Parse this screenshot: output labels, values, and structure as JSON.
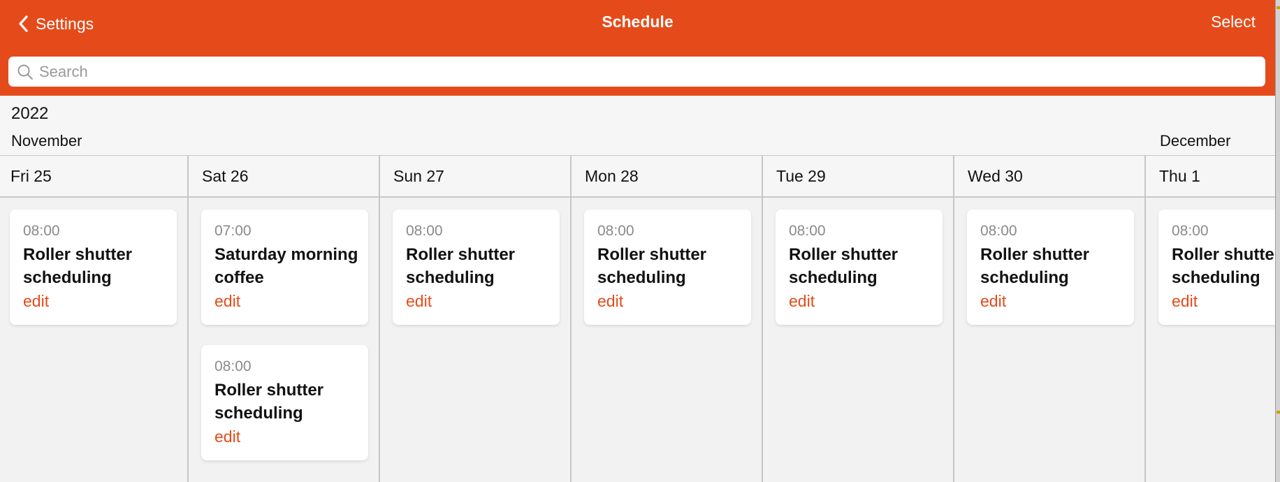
{
  "navbar": {
    "back_label": "Settings",
    "title": "Schedule",
    "select_label": "Select",
    "color": "#e54b1a"
  },
  "search": {
    "placeholder": "Search",
    "value": ""
  },
  "calendar": {
    "year": "2022",
    "months": [
      {
        "label": "November"
      },
      {
        "label": "December"
      }
    ],
    "days": [
      {
        "label": "Fri 25",
        "events": [
          {
            "time": "08:00",
            "name": "Roller shutter scheduling",
            "action": "edit"
          }
        ]
      },
      {
        "label": "Sat 26",
        "events": [
          {
            "time": "07:00",
            "name": "Saturday morning coffee",
            "action": "edit"
          },
          {
            "time": "08:00",
            "name": "Roller shutter scheduling",
            "action": "edit"
          }
        ]
      },
      {
        "label": "Sun 27",
        "events": [
          {
            "time": "08:00",
            "name": "Roller shutter scheduling",
            "action": "edit"
          }
        ]
      },
      {
        "label": "Mon 28",
        "events": [
          {
            "time": "08:00",
            "name": "Roller shutter scheduling",
            "action": "edit"
          }
        ]
      },
      {
        "label": "Tue 29",
        "events": [
          {
            "time": "08:00",
            "name": "Roller shutter scheduling",
            "action": "edit"
          }
        ]
      },
      {
        "label": "Wed 30",
        "events": [
          {
            "time": "08:00",
            "name": "Roller shutter scheduling",
            "action": "edit"
          }
        ]
      },
      {
        "label": "Thu 1",
        "events": [
          {
            "time": "08:00",
            "name": "Roller shutter scheduling",
            "action": "edit"
          }
        ]
      }
    ]
  }
}
